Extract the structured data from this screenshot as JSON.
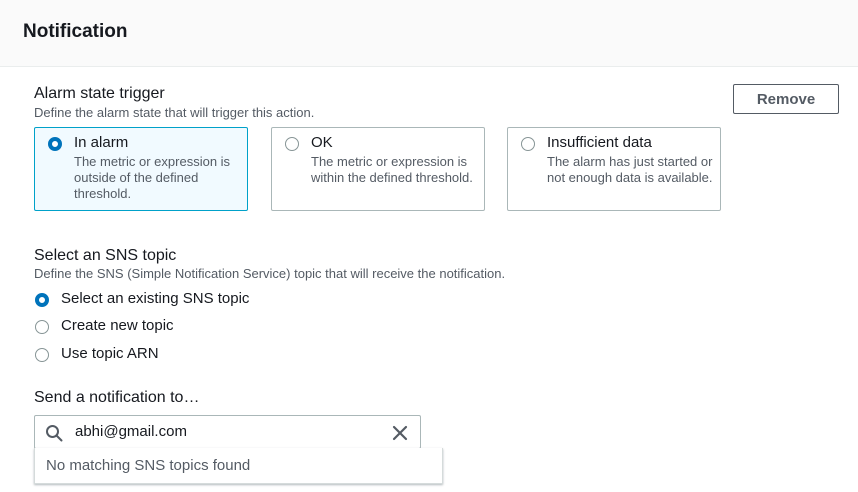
{
  "panel": {
    "title": "Notification"
  },
  "alarm_trigger": {
    "label": "Alarm state trigger",
    "description": "Define the alarm state that will trigger this action.",
    "remove_label": "Remove",
    "options": [
      {
        "title": "In alarm",
        "description": "The metric or expression is outside of the defined threshold.",
        "selected": true
      },
      {
        "title": "OK",
        "description": "The metric or expression is within the defined threshold.",
        "selected": false
      },
      {
        "title": "Insufficient data",
        "description": "The alarm has just started or not enough data is available.",
        "selected": false
      }
    ]
  },
  "sns_topic": {
    "label": "Select an SNS topic",
    "description": "Define the SNS (Simple Notification Service) topic that will receive the notification.",
    "options": [
      {
        "label": "Select an existing SNS topic",
        "selected": true
      },
      {
        "label": "Create new topic",
        "selected": false
      },
      {
        "label": "Use topic ARN",
        "selected": false
      }
    ]
  },
  "send_to": {
    "label": "Send a notification to…",
    "value": "abhi@gmail.com",
    "no_match": "No matching SNS topics found"
  },
  "colors": {
    "accent": "#0073bb",
    "selected_tile_bg": "#f1faff",
    "selected_tile_border": "#00a1c9"
  },
  "icons": {
    "search": "search-icon",
    "clear": "close-icon"
  }
}
